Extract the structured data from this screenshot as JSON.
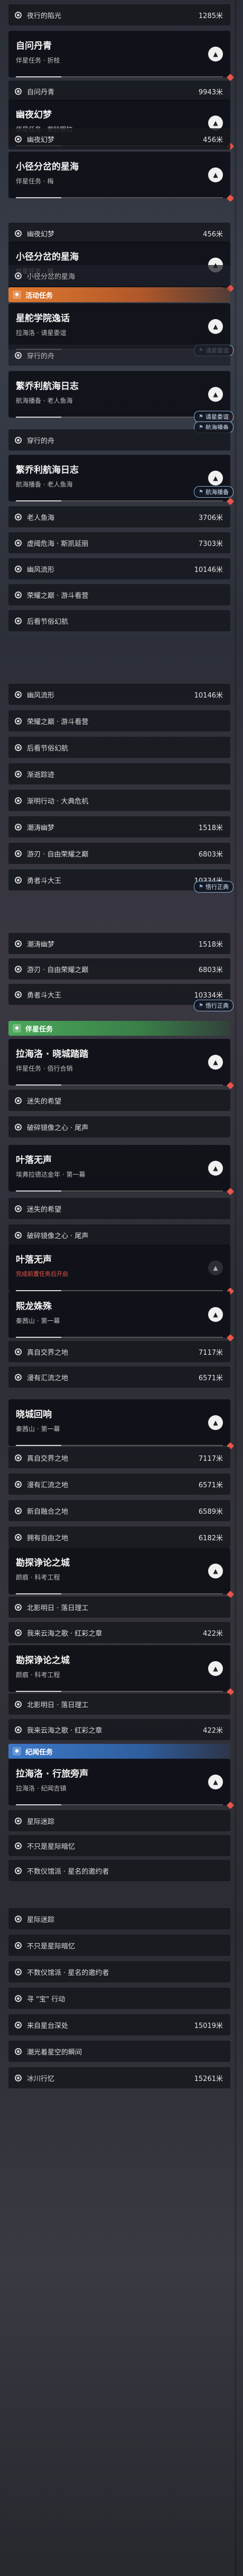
{
  "rows": [
    {
      "label": "夜行的陷光",
      "dist": "1285米"
    },
    {
      "label": "自问丹青",
      "dist": "9943米"
    },
    {
      "label": "幽夜幻梦",
      "dist": "456米"
    },
    {
      "label": "幽夜幻梦",
      "dist": "456米"
    },
    {
      "label": "小径分岔的星海",
      "dist": ""
    },
    {
      "label": "穿行的舟",
      "dist": ""
    },
    {
      "label": "穿行的舟",
      "dist": ""
    },
    {
      "label": "老人鱼海",
      "dist": "3706米"
    },
    {
      "label": "虚阈危海 · 斯凯延丽",
      "dist": "7303米"
    },
    {
      "label": "幽风流形",
      "dist": "10146米"
    },
    {
      "label": "荣耀之巅 · 游斗看营",
      "dist": ""
    },
    {
      "label": "后看节俗幻航",
      "dist": ""
    },
    {
      "label": "幽风流形",
      "dist": "10146米"
    },
    {
      "label": "荣耀之巅 · 游斗看营",
      "dist": ""
    },
    {
      "label": "后看节俗幻航",
      "dist": ""
    },
    {
      "label": "渐逝踪迹",
      "dist": ""
    },
    {
      "label": "渐明行动 · 大典危机",
      "dist": ""
    },
    {
      "label": "潮涛幽梦",
      "dist": "1518米"
    },
    {
      "label": "游刃 · 自由荣耀之巅",
      "dist": "6803米"
    },
    {
      "label": "勇者斗大王",
      "dist": "10334米"
    },
    {
      "label": "潮涛幽梦",
      "dist": "1518米"
    },
    {
      "label": "游刃 · 自由荣耀之巅",
      "dist": "6803米"
    },
    {
      "label": "勇者斗大王",
      "dist": "10334米"
    },
    {
      "label": "迷失的希望",
      "dist": ""
    },
    {
      "label": "破碎镜像之心 · 尾声",
      "dist": ""
    },
    {
      "label": "迷失的希望",
      "dist": ""
    },
    {
      "label": "破碎镜像之心 · 尾声",
      "dist": ""
    },
    {
      "label": "真自交界之地",
      "dist": "7117米"
    },
    {
      "label": "漫有汇流之地",
      "dist": "6571米"
    },
    {
      "label": "真自交界之地",
      "dist": "7117米"
    },
    {
      "label": "漫有汇流之地",
      "dist": "6571米"
    },
    {
      "label": "新自融合之地",
      "dist": "6589米"
    },
    {
      "label": "拥有自由之地",
      "dist": "6182米"
    },
    {
      "label": "北影明日 · 落日理工",
      "dist": ""
    },
    {
      "label": "我来云海之歌 · 红彩之章",
      "dist": "422米"
    },
    {
      "label": "北影明日 · 落日理工",
      "dist": ""
    },
    {
      "label": "我来云海之歌 · 红彩之章",
      "dist": "422米"
    },
    {
      "label": "星际迷踪",
      "dist": ""
    },
    {
      "label": "不只是星际暗忆",
      "dist": ""
    },
    {
      "label": "不数仪馆派 · 星名的邀约者",
      "dist": ""
    },
    {
      "label": "星际迷踪",
      "dist": ""
    },
    {
      "label": "不只是星际暗忆",
      "dist": ""
    },
    {
      "label": "不数仪馆派 · 星名的邀约者",
      "dist": ""
    },
    {
      "label": "寻 \"宝\" 行动",
      "dist": ""
    },
    {
      "label": "来自星台深处",
      "dist": "15019米"
    },
    {
      "label": "潮光着星空的瞬间",
      "dist": ""
    },
    {
      "label": "冰川行忆",
      "dist": "15261米"
    }
  ],
  "heads": [
    {
      "title": "自问丹青",
      "sub": "伴星任务 · 折枝"
    },
    {
      "title": "幽夜幻梦",
      "sub": "伴星任务 · 紫铃眼拉"
    },
    {
      "title": "小径分岔的星海",
      "sub": "伴星任务 · 梅"
    },
    {
      "title": "小径分岔的星海",
      "sub": "伴星任务 · 梅"
    },
    {
      "title": "星舵学院逸话",
      "sub": "拉海洛 · 请星委谊"
    },
    {
      "title": "繁乔利航海日志",
      "sub": "航海播备 · 老人鱼海"
    },
    {
      "title": "繁乔利航海日志",
      "sub": "航海播备 · 老人鱼海"
    },
    {
      "title": "拉海洛 · 晓城踏踏",
      "sub": "伴星任务 · 佰行合销"
    },
    {
      "title": "叶落无声",
      "sub": "埃弗拉德达金年 · 第一幕"
    },
    {
      "title": "叶落无声",
      "sub": "完成前置任务后开启"
    },
    {
      "title": "熙龙姝殊",
      "sub": "秦茜山 · 第一幕"
    },
    {
      "title": "晓城回响",
      "sub": "秦茜山 · 第一幕"
    },
    {
      "title": "勘探诤论之城",
      "sub": "颜痕 · 科考工程"
    },
    {
      "title": "勘探诤论之城",
      "sub": "颜痕 · 科考工程"
    },
    {
      "title": "拉海洛 · 行旅旁声",
      "sub": "拉海洛 · 纪闻吉镇"
    }
  ],
  "cats": [
    {
      "label": "活动任务"
    },
    {
      "label": "伴星任务"
    },
    {
      "label": "纪闻任务"
    }
  ],
  "tags": [
    {
      "label": "请星委谊"
    },
    {
      "label": "请星委谊"
    },
    {
      "label": "航海播备"
    },
    {
      "label": "航海播备"
    },
    {
      "label": "悟行正典"
    },
    {
      "label": "悟行正典"
    }
  ],
  "icons": {
    "dot": "target-dot-icon",
    "chev": "chevron-up-icon",
    "mark": "diamond-marker-icon"
  }
}
